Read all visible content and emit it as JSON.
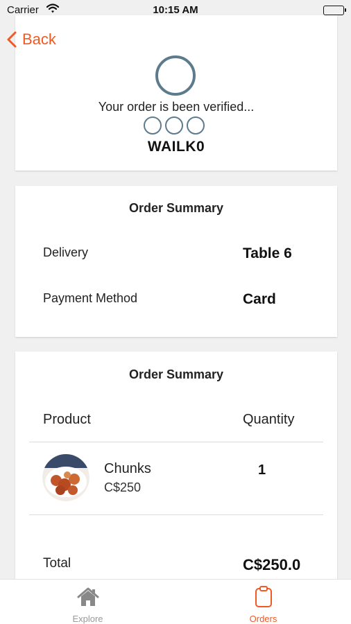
{
  "status_bar": {
    "carrier": "Carrier",
    "time": "10:15 AM"
  },
  "header": {
    "back_label": "Back"
  },
  "verification": {
    "message": "Your order is been verified...",
    "code": "WAILK0"
  },
  "order_summary": {
    "title": "Order Summary",
    "rows": [
      {
        "label": "Delivery",
        "value": "Table 6"
      },
      {
        "label": "Payment Method",
        "value": "Card"
      }
    ]
  },
  "products_summary": {
    "title": "Order Summary",
    "columns": {
      "product": "Product",
      "quantity": "Quantity"
    },
    "items": [
      {
        "name": "Chunks",
        "price": "C$250",
        "quantity": "1"
      }
    ],
    "total_label": "Total",
    "total_value": "C$250.0"
  },
  "tab_bar": {
    "items": [
      {
        "label": "Explore",
        "icon": "home-icon",
        "active": false
      },
      {
        "label": "Orders",
        "icon": "clipboard-icon",
        "active": true
      }
    ]
  },
  "colors": {
    "accent": "#f05a22",
    "spinner": "#5d7b8c",
    "inactive": "#999999"
  }
}
